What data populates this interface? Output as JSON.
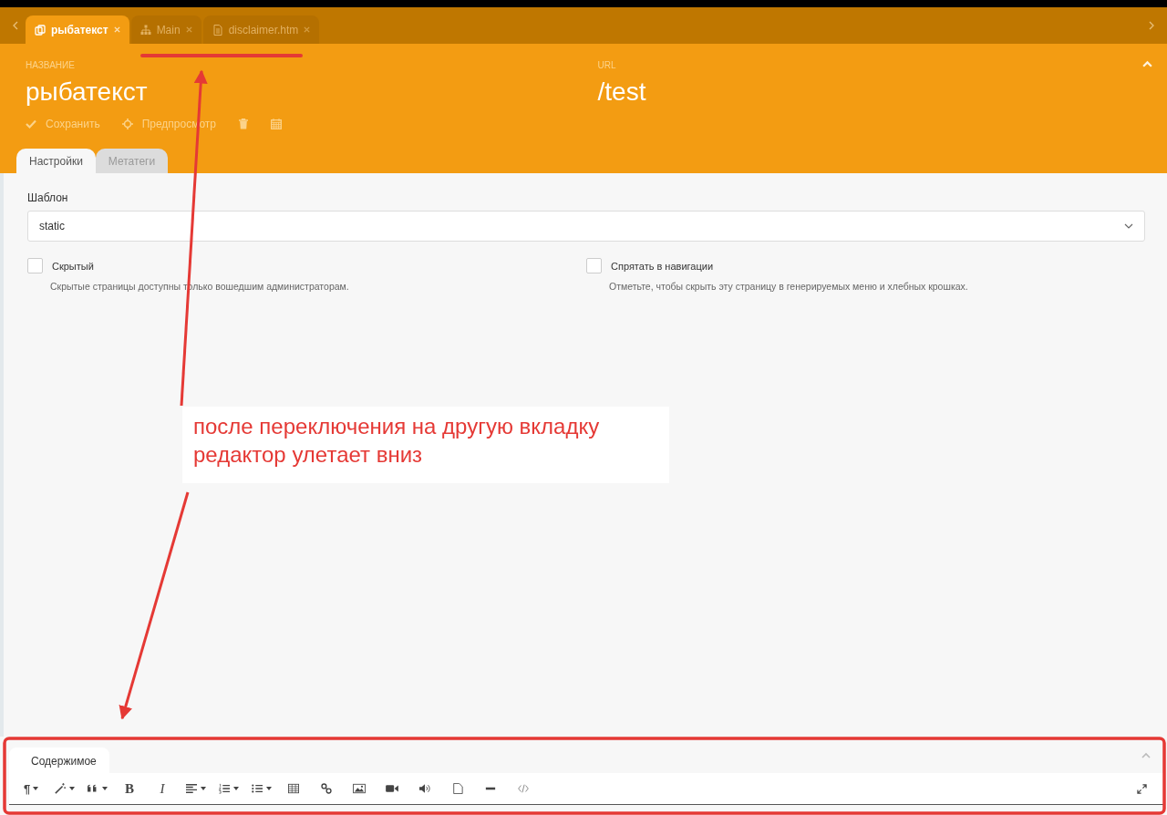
{
  "doc_tabs": [
    {
      "label": "рыбатекст",
      "kind": "page",
      "selected": true
    },
    {
      "label": "Main",
      "kind": "sitemap",
      "selected": false
    },
    {
      "label": "disclaimer.htm",
      "kind": "file",
      "selected": false
    }
  ],
  "header": {
    "title_label": "НАЗВАНИЕ",
    "title": "рыбатекст",
    "url_label": "URL",
    "url": "/test",
    "actions": [
      {
        "kind": "save",
        "label": "Сохранить"
      },
      {
        "kind": "preview",
        "label": "Предпросмотр"
      },
      {
        "kind": "delete"
      },
      {
        "kind": "schedule"
      }
    ]
  },
  "form_tabs": [
    {
      "label": "Настройки",
      "selected": true
    },
    {
      "label": "Метатеги",
      "selected": false
    }
  ],
  "template": {
    "label": "Шаблон",
    "value": "static"
  },
  "options": [
    {
      "label": "Скрытый",
      "hint": "Скрытые страницы доступны только вошедшим администраторам.",
      "checked": false
    },
    {
      "label": "Спрятать в навигации",
      "hint": "Отметьте, чтобы скрыть эту страницу в генерируемых меню и хлебных крошках.",
      "checked": false
    }
  ],
  "editor": {
    "tab": "Содержимое",
    "toolbar": [
      {
        "kind": "paragraph",
        "glyph": "¶",
        "caret": true
      },
      {
        "kind": "style",
        "caret": true
      },
      {
        "kind": "quote",
        "caret": true
      },
      {
        "kind": "bold",
        "glyph": "B",
        "caret": false
      },
      {
        "kind": "italic",
        "glyph": "I",
        "caret": false
      },
      {
        "kind": "align",
        "caret": true
      },
      {
        "kind": "ol",
        "caret": true
      },
      {
        "kind": "ul",
        "caret": true
      },
      {
        "kind": "table",
        "caret": false
      },
      {
        "kind": "link",
        "caret": false
      },
      {
        "kind": "picture",
        "caret": false
      },
      {
        "kind": "video",
        "caret": false
      },
      {
        "kind": "audio",
        "caret": false
      },
      {
        "kind": "file",
        "caret": false
      },
      {
        "kind": "rule",
        "caret": false
      },
      {
        "kind": "code",
        "caret": false
      }
    ]
  },
  "annotation": {
    "note": "после переключения на другую вкладку редактор улетает вниз"
  }
}
